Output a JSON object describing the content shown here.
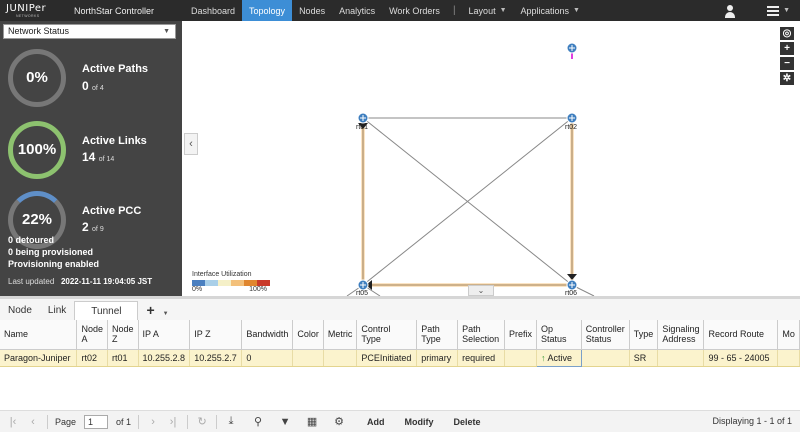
{
  "nav": {
    "logo_main": "JUNIPer",
    "logo_sub": "NETWORKS",
    "app_title": "NorthStar Controller",
    "items": [
      {
        "label": "Dashboard"
      },
      {
        "label": "Topology"
      },
      {
        "label": "Nodes"
      },
      {
        "label": "Analytics"
      },
      {
        "label": "Work Orders"
      }
    ],
    "separator": "|",
    "layout_label": "Layout",
    "applications_label": "Applications",
    "active_item": "Topology"
  },
  "left": {
    "select_value": "Network Status",
    "paths": {
      "pct": "0%",
      "title": "Active Paths",
      "value": "0",
      "of": "of 4"
    },
    "links": {
      "pct": "100%",
      "title": "Active Links",
      "value": "14",
      "of": "of 14"
    },
    "pcc": {
      "pct": "22%",
      "title": "Active PCC",
      "value": "2",
      "of": "of 9"
    },
    "pcc_detoured": "0 detoured",
    "pcc_provisioning": "0 being provisioned",
    "pcc_enabled": "Provisioning enabled",
    "last_updated_label": "Last updated",
    "last_updated_value": "2022-11-11 19:04:05 JST"
  },
  "map": {
    "nodes": [
      {
        "label": "rt01"
      },
      {
        "label": "rt02"
      },
      {
        "label": "rt05"
      },
      {
        "label": "rt06"
      }
    ],
    "legend_title": "Interface Utilization",
    "legend_min": "0%",
    "legend_max": "100%",
    "legend_colors": [
      "#4a7fc0",
      "#a9cfe8",
      "#f5f0c8",
      "#f3c07a",
      "#e0862e",
      "#c93a2a"
    ],
    "link_color": "#7f7f7f",
    "path_color": "#f7c98a",
    "tools": [
      "◎",
      "+",
      "−",
      "✲"
    ]
  },
  "tabs": {
    "items": [
      {
        "label": "Node"
      },
      {
        "label": "Link"
      },
      {
        "label": "Tunnel"
      }
    ],
    "active": "Tunnel",
    "add": "+"
  },
  "table": {
    "columns": [
      "Name",
      "Node A",
      "Node Z",
      "IP A",
      "IP Z",
      "Bandwidth",
      "Color",
      "Metric",
      "Control Type",
      "Path Type",
      "Path Selection",
      "Prefix",
      "Op Status",
      "Controller Status",
      "Type",
      "Signaling Address",
      "Record Route",
      "Mo"
    ],
    "rows": [
      {
        "name": "Paragon-Juniper",
        "node_a": "rt02",
        "node_z": "rt01",
        "ip_a": "10.255.2.8",
        "ip_z": "10.255.2.7",
        "bandwidth": "0",
        "color": "",
        "metric": "",
        "control_type": "PCEInitiated",
        "path_type": "primary",
        "path_selection": "required",
        "prefix": "",
        "op_status": "Active",
        "controller_status": "",
        "type": "SR",
        "signaling_address": "",
        "record_route": "99 - 65 - 24005",
        "mo": ""
      }
    ]
  },
  "footer": {
    "page_label": "Page",
    "page_value": "1",
    "of_label": "of 1",
    "add": "Add",
    "modify": "Modify",
    "delete": "Delete",
    "displaying": "Displaying 1 - 1 of 1"
  }
}
